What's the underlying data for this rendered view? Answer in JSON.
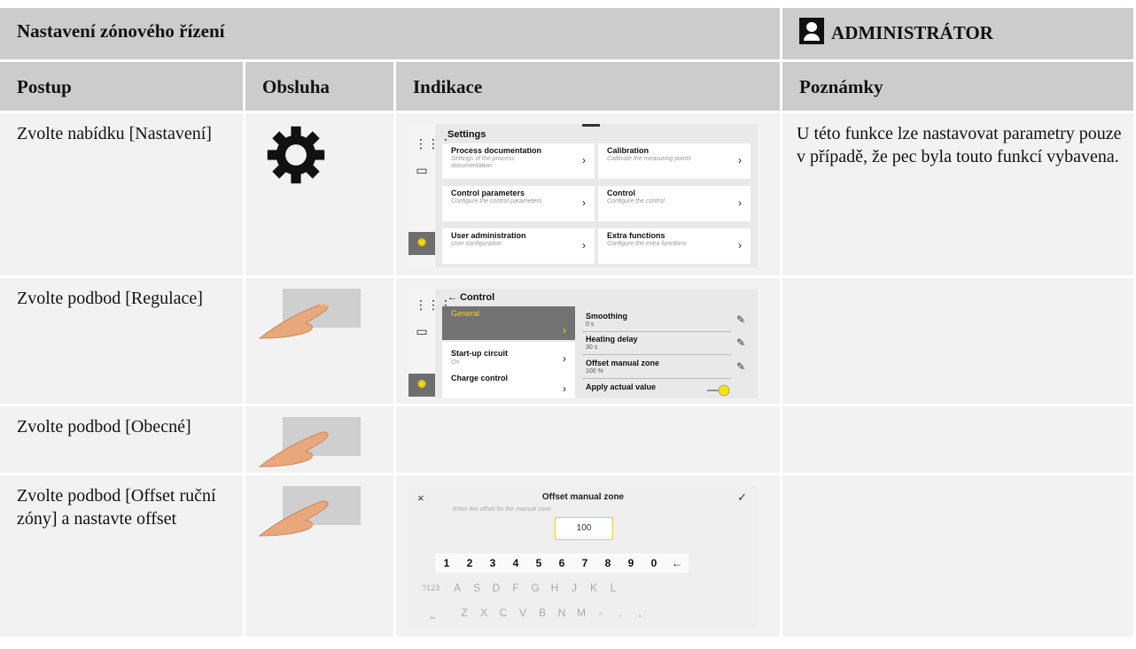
{
  "top_fragment": "",
  "header": {
    "title": "Nastavení zónového řízení",
    "role": "ADMINISTRÁTOR",
    "role_icon": "user-icon"
  },
  "columns": {
    "postup": "Postup",
    "obsluha": "Obsluha",
    "indikace": "Indikace",
    "poznamky": "Poznámky"
  },
  "rows": [
    {
      "step": "Zvolte nabídku [Nastavení]",
      "icon": "gear-icon",
      "note": "U této funkce lze nastavovat parametry pouze v případě, že pec byla touto funkcí vybavena."
    },
    {
      "step": "Zvolte podbod [Regulace]",
      "icon": "finger-tap-icon",
      "note": ""
    },
    {
      "step": "Zvolte podbod [Obecné]",
      "icon": "finger-tap-icon",
      "note": ""
    },
    {
      "step": "Zvolte podbod [Offset ruční zóny] a nastavte offset",
      "icon": "finger-tap-icon",
      "note": ""
    }
  ],
  "screen_settings": {
    "title": "Settings",
    "cards": [
      {
        "title": "Process documentation",
        "sub": "Settings of the process documentation"
      },
      {
        "title": "Calibration",
        "sub": "Calibrate the measuring points"
      },
      {
        "title": "Control parameters",
        "sub": "Configure the control parameters"
      },
      {
        "title": "Control",
        "sub": "Configure the control"
      },
      {
        "title": "User administration",
        "sub": "User configuration"
      },
      {
        "title": "Extra functions",
        "sub": "Configure the extra functions"
      }
    ]
  },
  "screen_control": {
    "title": "← Control",
    "left": [
      {
        "title": "General",
        "sub": ""
      },
      {
        "title": "Start-up circuit",
        "sub": "On"
      },
      {
        "title": "Charge control",
        "sub": ""
      }
    ],
    "right": [
      {
        "title": "Smoothing",
        "value": "0 s"
      },
      {
        "title": "Heating delay",
        "value": "30 s"
      },
      {
        "title": "Offset manual zone",
        "value": "100 %"
      },
      {
        "title": "Apply actual value",
        "value": ""
      }
    ]
  },
  "screen_keyboard": {
    "close": "×",
    "title": "Offset manual zone",
    "confirm": "✓",
    "hint": "Enter the offset for the manual zone",
    "value": "100",
    "row1": [
      "1",
      "2",
      "3",
      "4",
      "5",
      "6",
      "7",
      "8",
      "9",
      "0",
      "←"
    ],
    "row2": [
      ".?123",
      "A",
      "S",
      "D",
      "F",
      "G",
      "H",
      "J",
      "K",
      "L"
    ],
    "row3": [
      "⎵",
      "Z",
      "X",
      "C",
      "V",
      "B",
      "N",
      "M",
      "-",
      ".",
      ","
    ]
  }
}
